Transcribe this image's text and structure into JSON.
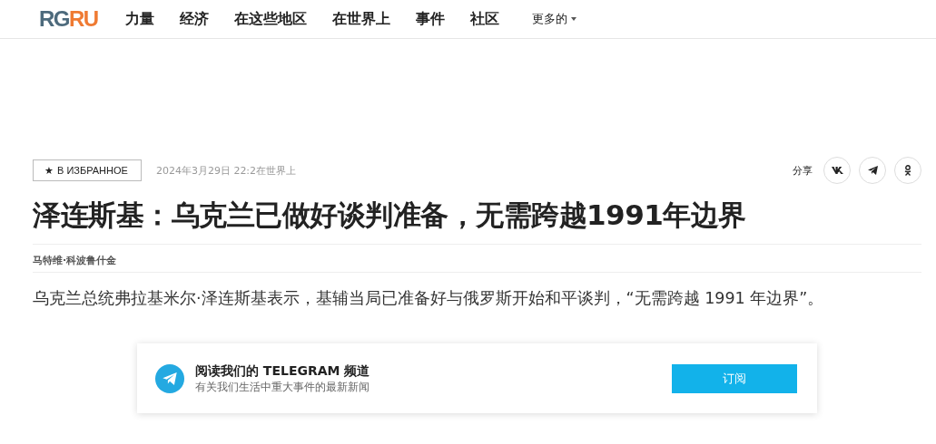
{
  "header": {
    "logo": {
      "left": "RG",
      "right": "RU"
    },
    "nav": [
      "力量",
      "经济",
      "在这些地区",
      "在世界上",
      "事件",
      "社区"
    ],
    "more": "更多的"
  },
  "meta": {
    "favorite": {
      "icon": "★",
      "label": "В ИЗБРАННОЕ"
    },
    "date": "2024年3月29日 22:2",
    "category": "在世界上",
    "share_label": "分享",
    "share": [
      {
        "kind": "vk"
      },
      {
        "kind": "telegram"
      },
      {
        "kind": "ok"
      }
    ]
  },
  "article": {
    "title": "泽连斯基：乌克兰已做好谈判准备，无需跨越1991年边界",
    "author": "马特维·科波鲁什金",
    "lead": "乌克兰总统弗拉基米尔·泽连斯基表示，基辅当局已准备好与俄罗斯开始和平谈判，“无需跨越 1991 年边界”。"
  },
  "promo": {
    "title": "阅读我们的 TELEGRAM 频道",
    "subtitle": "有关我们生活中重大事件的最新新闻",
    "button": "订阅"
  }
}
